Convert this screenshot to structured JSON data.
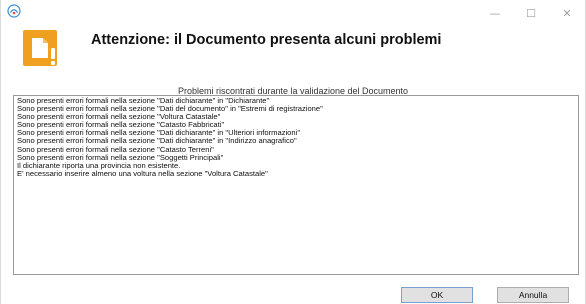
{
  "window": {
    "app_icon": "app-logo-icon",
    "controls": {
      "minimize": "—",
      "maximize": "☐",
      "close": "✕"
    }
  },
  "header": {
    "icon": "warning-document-icon",
    "icon_color": "#f0a020",
    "title": "Attenzione: il Documento presenta alcuni problemi"
  },
  "messages": {
    "group_label": "Problemi riscontrati durante la validazione del Documento",
    "lines": [
      "Sono presenti errori formali nella sezione \"Dati dichiarante\" in \"Dichiarante\"",
      "Sono presenti errori formali nella sezione \"Dati del documento\" in \"Estremi di registrazione\"",
      "Sono presenti errori formali nella sezione \"Voltura Catastale\"",
      "Sono presenti errori formali nella sezione \"Catasto Fabbricati\"",
      "Sono presenti errori formali nella sezione \"Dati dichiarante\" in \"Ulteriori informazioni\"",
      "Sono presenti errori formali nella sezione \"Dati dichiarante\" in \"Indirizzo anagrafico\"",
      "Sono presenti errori formali nella sezione \"Catasto Terreni\"",
      "Sono presenti errori formali nella sezione \"Soggetti Principali\"",
      "Il dichiarante riporta una provincia non esistente.",
      "E' necessario inserire almeno una voltura nella sezione \"Voltura Catastale\""
    ]
  },
  "buttons": {
    "ok": "OK",
    "cancel": "Annulla"
  }
}
